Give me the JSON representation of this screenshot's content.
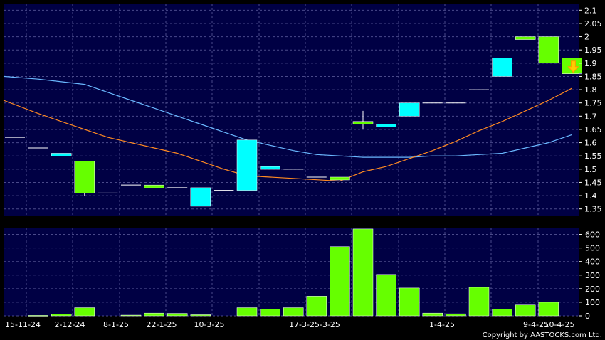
{
  "chart_data": [
    {
      "type": "candlestick",
      "panel": "price",
      "ylim": [
        1.325,
        2.125
      ],
      "y_ticks": [
        1.35,
        1.4,
        1.45,
        1.5,
        1.55,
        1.6,
        1.65,
        1.7,
        1.75,
        1.8,
        1.85,
        1.9,
        1.95,
        2,
        2.05,
        2.1
      ],
      "y_tick_labels": [
        "1.35",
        "1.4",
        "1.45",
        "1.5",
        "1.55",
        "1.6",
        "1.65",
        "1.7",
        "1.75",
        "1.8",
        "1.85",
        "1.9",
        "1.95",
        "2",
        "2.05",
        "2.1"
      ],
      "grid": true,
      "candles": [
        {
          "open": 1.62,
          "close": 1.62,
          "high": 1.62,
          "low": 1.62,
          "direction": "flat"
        },
        {
          "open": 1.58,
          "close": 1.58,
          "high": 1.58,
          "low": 1.58,
          "direction": "flat"
        },
        {
          "open": 1.55,
          "close": 1.56,
          "high": 1.56,
          "low": 1.55,
          "direction": "up"
        },
        {
          "open": 1.53,
          "close": 1.41,
          "high": 1.53,
          "low": 1.4,
          "direction": "down"
        },
        {
          "open": 1.41,
          "close": 1.41,
          "high": 1.41,
          "low": 1.41,
          "direction": "flat"
        },
        {
          "open": 1.44,
          "close": 1.44,
          "high": 1.44,
          "low": 1.44,
          "direction": "flat"
        },
        {
          "open": 1.44,
          "close": 1.43,
          "high": 1.44,
          "low": 1.43,
          "direction": "down"
        },
        {
          "open": 1.43,
          "close": 1.43,
          "high": 1.43,
          "low": 1.43,
          "direction": "flat"
        },
        {
          "open": 1.36,
          "close": 1.43,
          "high": 1.43,
          "low": 1.36,
          "direction": "up"
        },
        {
          "open": 1.42,
          "close": 1.42,
          "high": 1.42,
          "low": 1.42,
          "direction": "flat"
        },
        {
          "open": 1.42,
          "close": 1.61,
          "high": 1.61,
          "low": 1.42,
          "direction": "up"
        },
        {
          "open": 1.5,
          "close": 1.51,
          "high": 1.51,
          "low": 1.5,
          "direction": "up"
        },
        {
          "open": 1.5,
          "close": 1.5,
          "high": 1.5,
          "low": 1.5,
          "direction": "flat"
        },
        {
          "open": 1.47,
          "close": 1.47,
          "high": 1.47,
          "low": 1.47,
          "direction": "flat"
        },
        {
          "open": 1.47,
          "close": 1.46,
          "high": 1.47,
          "low": 1.46,
          "direction": "down"
        },
        {
          "open": 1.68,
          "close": 1.67,
          "high": 1.72,
          "low": 1.65,
          "direction": "down"
        },
        {
          "open": 1.66,
          "close": 1.67,
          "high": 1.67,
          "low": 1.66,
          "direction": "up"
        },
        {
          "open": 1.7,
          "close": 1.75,
          "high": 1.75,
          "low": 1.7,
          "direction": "up"
        },
        {
          "open": 1.75,
          "close": 1.75,
          "high": 1.75,
          "low": 1.75,
          "direction": "flat"
        },
        {
          "open": 1.75,
          "close": 1.75,
          "high": 1.75,
          "low": 1.75,
          "direction": "flat"
        },
        {
          "open": 1.8,
          "close": 1.8,
          "high": 1.8,
          "low": 1.8,
          "direction": "flat"
        },
        {
          "open": 1.85,
          "close": 1.92,
          "high": 1.92,
          "low": 1.85,
          "direction": "up"
        },
        {
          "open": 2.0,
          "close": 1.99,
          "high": 2.0,
          "low": 1.99,
          "direction": "down"
        },
        {
          "open": 2.0,
          "close": 1.9,
          "high": 2.0,
          "low": 1.9,
          "direction": "down"
        },
        {
          "open": 1.92,
          "close": 1.86,
          "high": 1.92,
          "low": 1.86,
          "direction": "down"
        }
      ],
      "moving_averages": [
        {
          "color": "#6ab8ff",
          "values": [
            1.85,
            1.84,
            1.83,
            1.82,
            1.79,
            1.76,
            1.73,
            1.7,
            1.67,
            1.64,
            1.61,
            1.59,
            1.57,
            1.555,
            1.55,
            1.545,
            1.545,
            1.545,
            1.55,
            1.55,
            1.555,
            1.56,
            1.58,
            1.6,
            1.63
          ]
        },
        {
          "color": "#ff8a22",
          "values": [
            1.76,
            1.71,
            1.68,
            1.65,
            1.62,
            1.6,
            1.58,
            1.56,
            1.53,
            1.5,
            1.475,
            1.47,
            1.465,
            1.46,
            1.455,
            1.49,
            1.51,
            1.54,
            1.57,
            1.605,
            1.645,
            1.68,
            1.72,
            1.76,
            1.805
          ]
        }
      ],
      "last_price": 1.86,
      "colors": {
        "up": "#00ffff",
        "down": "#66ff00",
        "background": "#000044",
        "grid": "#4a4a8a",
        "arrow": "#ffcc00"
      }
    },
    {
      "type": "bar",
      "panel": "volume",
      "ylim": [
        0,
        650
      ],
      "y_ticks": [
        0,
        100,
        200,
        300,
        400,
        500,
        600
      ],
      "y_tick_labels": [
        "0",
        "100",
        "200",
        "300",
        "400",
        "500",
        "600"
      ],
      "values": [
        0,
        3,
        12,
        60,
        0,
        5,
        20,
        18,
        8,
        0,
        60,
        50,
        60,
        145,
        510,
        640,
        305,
        205,
        20,
        15,
        210,
        50,
        80,
        100,
        0
      ],
      "grid": true
    }
  ],
  "x_axis": {
    "tick_labels": [
      "15-11-24",
      "2-12-24",
      "8-1-25",
      "22-1-25",
      "10-3-25",
      "17-3-25-3-25",
      "1-4-25",
      "9-4-25",
      "10-4-25"
    ]
  },
  "copyright": "Copyright by AASTOCKS.com Ltd."
}
